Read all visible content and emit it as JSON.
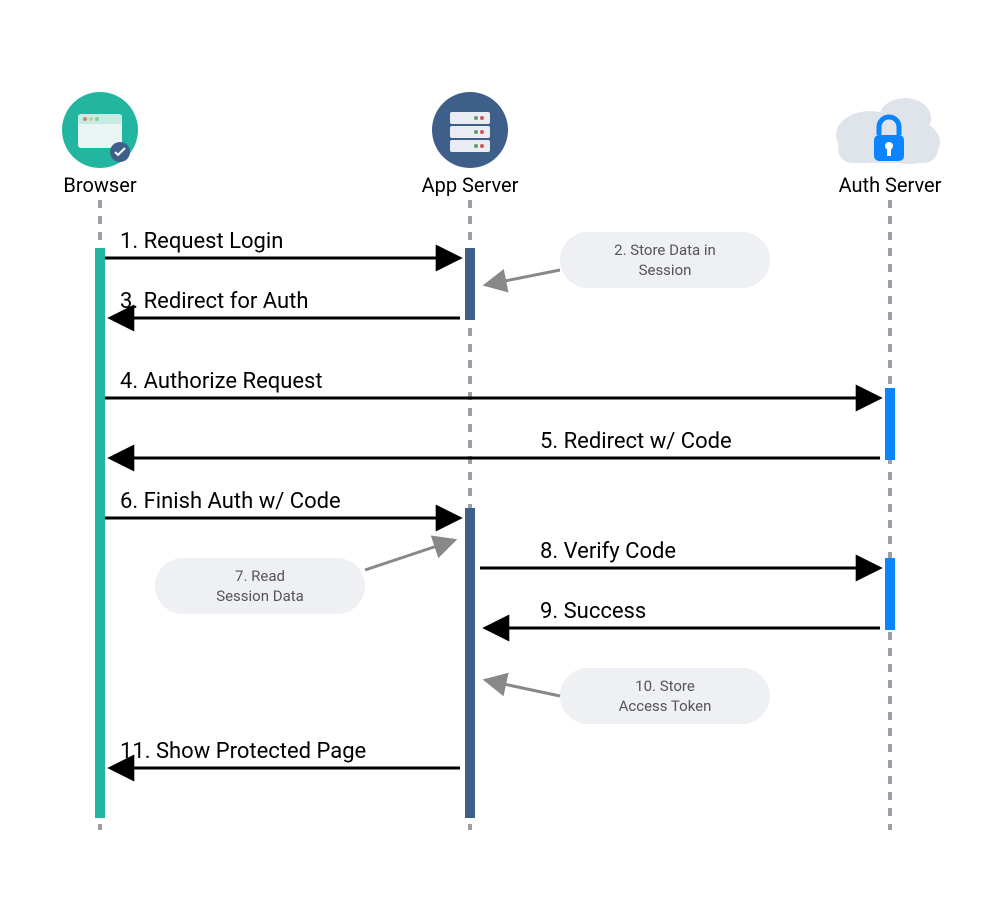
{
  "actors": {
    "browser": {
      "label": "Browser",
      "color": "#22b5a0"
    },
    "app": {
      "label": "App Server",
      "color": "#3e5f8a"
    },
    "auth": {
      "label": "Auth Server",
      "color": "#0a84ff"
    }
  },
  "messages": {
    "m1": "1. Request Login",
    "m3": "3. Redirect for Auth",
    "m4": "4. Authorize Request",
    "m5": "5. Redirect w/ Code",
    "m6": "6. Finish Auth w/ Code",
    "m8": "8. Verify Code",
    "m9": "9. Success",
    "m11": "11. Show Protected Page"
  },
  "notes": {
    "n2a": "2. Store Data in",
    "n2b": "Session",
    "n7a": "7. Read",
    "n7b": "Session Data",
    "n10a": "10. Store",
    "n10b": "Access Token"
  }
}
